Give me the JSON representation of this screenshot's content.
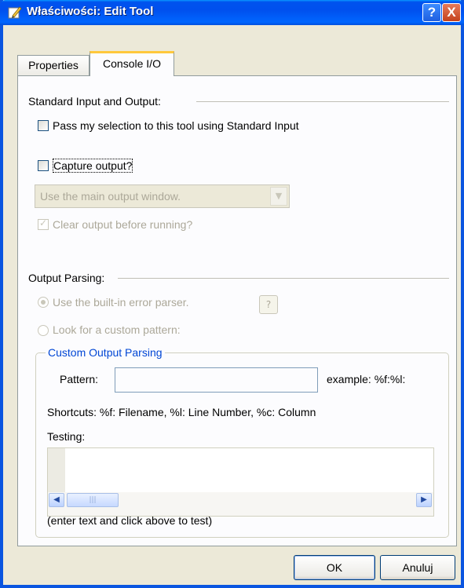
{
  "window": {
    "title": "Właściwości: Edit Tool",
    "icon": "pencil-icon",
    "help_button": "?",
    "close_button": "X"
  },
  "tabs": [
    {
      "label": "Properties",
      "active": false
    },
    {
      "label": "Console I/O",
      "active": true
    }
  ],
  "std_io": {
    "section_title": "Standard Input and Output:",
    "pass_selection": {
      "label": "Pass my selection to this tool using Standard Input",
      "checked": false
    },
    "capture_output": {
      "label": "Capture output?",
      "checked": false
    },
    "output_window_select": {
      "value": "Use the main output window.",
      "enabled": false
    },
    "clear_output": {
      "label": "Clear output before running?",
      "checked": true,
      "enabled": false
    }
  },
  "output_parsing": {
    "section_title": "Output Parsing:",
    "builtin_parser": {
      "label": "Use the built-in error parser.",
      "selected": true,
      "enabled": false
    },
    "help_button": "?",
    "custom_pattern": {
      "label": "Look for a custom pattern:",
      "selected": false,
      "enabled": false
    },
    "custom_group": {
      "title": "Custom Output Parsing",
      "pattern_label": "Pattern:",
      "pattern_value": "",
      "example": "example: %f:%l:",
      "shortcuts": "Shortcuts: %f: Filename, %l: Line Number, %c: Column",
      "testing_label": "Testing:",
      "testing_hint": "(enter text and click above to test)"
    }
  },
  "buttons": {
    "ok": "OK",
    "cancel": "Anuluj"
  },
  "colors": {
    "titlebar": "#0053ee",
    "dialog_bg": "#ece9d8",
    "group_title": "#0046d5",
    "tab_highlight": "#ffc83c"
  }
}
